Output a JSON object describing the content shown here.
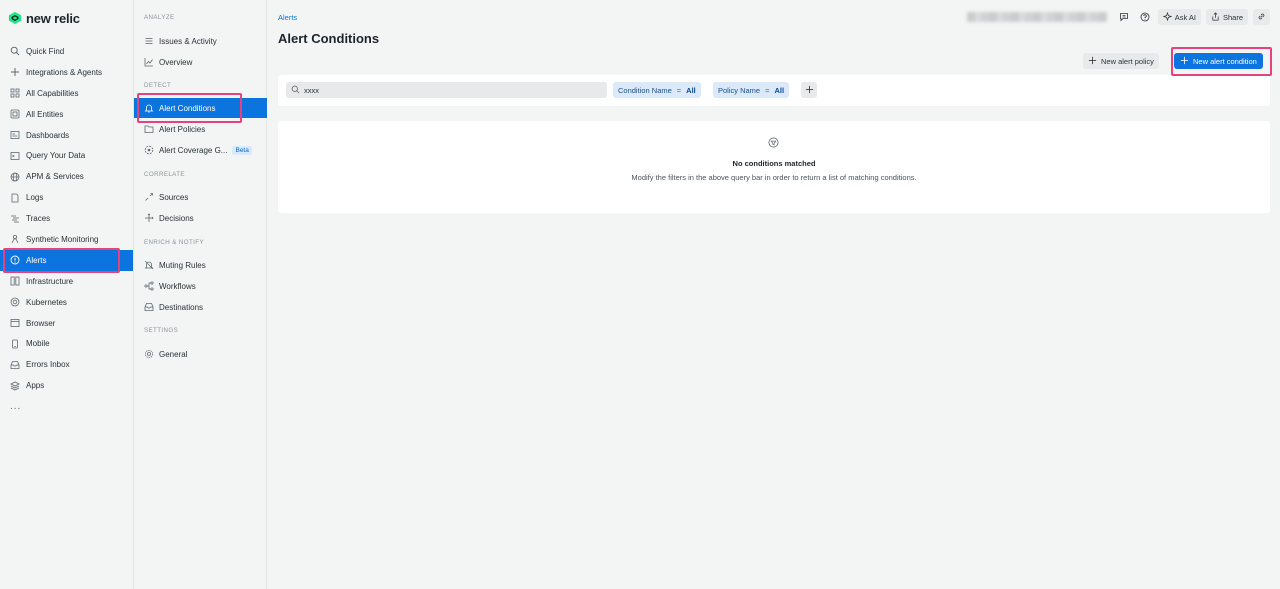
{
  "app": {
    "logo_text": "new relic"
  },
  "leftnav": {
    "items": [
      {
        "label": "Quick Find",
        "icon": "search-icon"
      },
      {
        "label": "Integrations & Agents",
        "icon": "plus-icon"
      },
      {
        "label": "All Capabilities",
        "icon": "grid-icon"
      },
      {
        "label": "All Entities",
        "icon": "entities-icon"
      },
      {
        "label": "Dashboards",
        "icon": "dashboard-icon"
      },
      {
        "label": "Query Your Data",
        "icon": "query-icon"
      },
      {
        "label": "APM & Services",
        "icon": "globe-icon"
      },
      {
        "label": "Logs",
        "icon": "logs-icon"
      },
      {
        "label": "Traces",
        "icon": "traces-icon"
      },
      {
        "label": "Synthetic Monitoring",
        "icon": "synthetic-icon"
      },
      {
        "label": "Alerts",
        "icon": "alert-icon",
        "active": true
      },
      {
        "label": "Infrastructure",
        "icon": "infrastructure-icon"
      },
      {
        "label": "Kubernetes",
        "icon": "kubernetes-icon"
      },
      {
        "label": "Browser",
        "icon": "browser-icon"
      },
      {
        "label": "Mobile",
        "icon": "mobile-icon"
      },
      {
        "label": "Errors Inbox",
        "icon": "inbox-icon"
      },
      {
        "label": "Apps",
        "icon": "apps-icon"
      }
    ],
    "more": "..."
  },
  "subnav": {
    "sections": {
      "analyze": "ANALYZE",
      "detect": "DETECT",
      "correlate": "CORRELATE",
      "enrich": "ENRICH & NOTIFY",
      "settings": "SETTINGS"
    },
    "items": {
      "issues": "Issues & Activity",
      "overview": "Overview",
      "alert_conditions": "Alert Conditions",
      "alert_policies": "Alert Policies",
      "alert_coverage": "Alert Coverage G...",
      "beta": "Beta",
      "sources": "Sources",
      "decisions": "Decisions",
      "muting": "Muting Rules",
      "workflows": "Workflows",
      "destinations": "Destinations",
      "general": "General"
    }
  },
  "header": {
    "breadcrumb": "Alerts",
    "title": "Alert Conditions",
    "ask_ai": "Ask AI",
    "share": "Share"
  },
  "actions": {
    "new_policy": "New alert policy",
    "new_condition": "New alert condition"
  },
  "filters": {
    "search_value": "xxxx",
    "chips": [
      {
        "name": "Condition Name",
        "op": "=",
        "value": "All"
      },
      {
        "name": "Policy Name",
        "op": "=",
        "value": "All"
      }
    ]
  },
  "empty_state": {
    "title": "No conditions matched",
    "description": "Modify the filters in the above query bar in order to return a list of matching conditions."
  },
  "colors": {
    "accent": "#0c74df",
    "highlight": "#e8417e"
  }
}
